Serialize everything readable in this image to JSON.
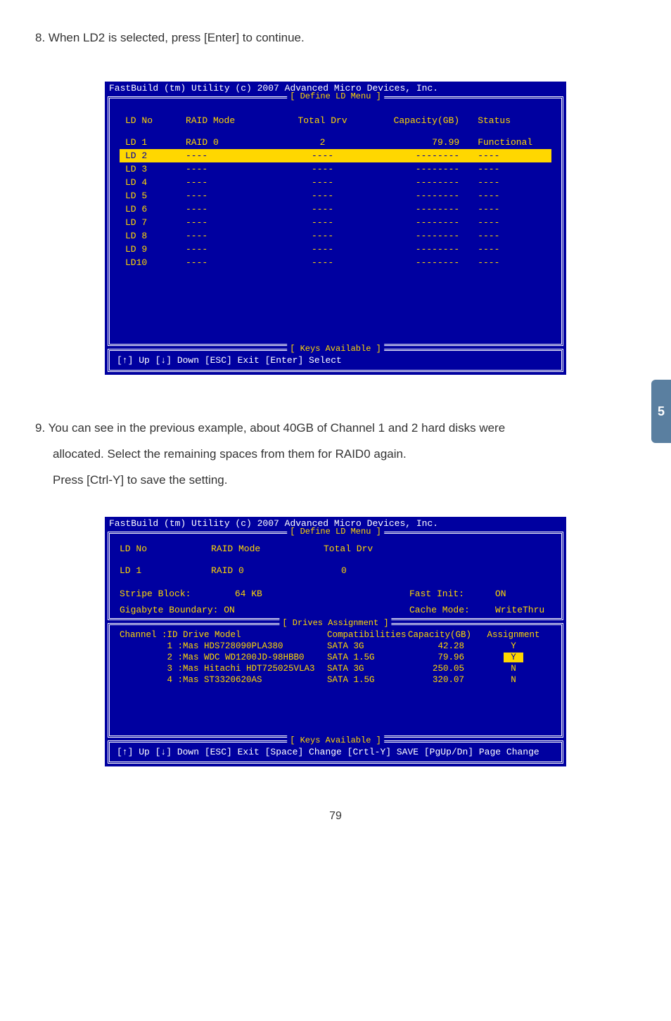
{
  "step8": "8. When LD2 is selected, press [Enter] to continue.",
  "step9_line1": "9. You can see in the previous example, about 40GB of Channel 1 and 2 hard disks were",
  "step9_line2": "allocated. Select the remaining spaces from them for RAID0 again.",
  "step9_line3": "Press [Ctrl-Y] to save the setting.",
  "bios_title": "FastBuild (tm) Utility (c) 2007 Advanced Micro Devices, Inc.",
  "frame1_title": "[ Define LD Menu ]",
  "keys_title": "[ Keys Available ]",
  "drives_title": "[ Drives Assignment ]",
  "screen1": {
    "headers": {
      "ldno": "LD No",
      "raid": "RAID Mode",
      "total": "Total Drv",
      "cap": "Capacity(GB)",
      "status": "Status"
    },
    "rows": [
      {
        "ldno": "LD  1",
        "raid": "RAID 0",
        "total": "2",
        "cap": "79.99",
        "status": "Functional",
        "selected": false
      },
      {
        "ldno": "LD  2",
        "raid": "----",
        "total": "----",
        "cap": "--------",
        "status": "----",
        "selected": true
      },
      {
        "ldno": "LD  3",
        "raid": "----",
        "total": "----",
        "cap": "--------",
        "status": "----",
        "selected": false
      },
      {
        "ldno": "LD  4",
        "raid": "----",
        "total": "----",
        "cap": "--------",
        "status": "----",
        "selected": false
      },
      {
        "ldno": "LD  5",
        "raid": "----",
        "total": "----",
        "cap": "--------",
        "status": "----",
        "selected": false
      },
      {
        "ldno": "LD  6",
        "raid": "----",
        "total": "----",
        "cap": "--------",
        "status": "----",
        "selected": false
      },
      {
        "ldno": "LD  7",
        "raid": "----",
        "total": "----",
        "cap": "--------",
        "status": "----",
        "selected": false
      },
      {
        "ldno": "LD  8",
        "raid": "----",
        "total": "----",
        "cap": "--------",
        "status": "----",
        "selected": false
      },
      {
        "ldno": "LD  9",
        "raid": "----",
        "total": "----",
        "cap": "--------",
        "status": "----",
        "selected": false
      },
      {
        "ldno": "LD10",
        "raid": "----",
        "total": "----",
        "cap": "--------",
        "status": "----",
        "selected": false
      }
    ],
    "keys": "[↑] Up    [↓] Down    [ESC] Exit    [Enter] Select"
  },
  "screen2": {
    "ldno_label": "LD No",
    "raid_label": "RAID Mode",
    "total_label": "Total Drv",
    "ld_val": "LD  1",
    "raid_val": "RAID 0",
    "total_val": "0",
    "stripe_label": "Stripe Block:",
    "stripe_val": "64  KB",
    "giga_label": "Gigabyte Boundary:",
    "giga_val": "ON",
    "fast_label": "Fast Init:",
    "fast_val": "ON",
    "cache_label": "Cache Mode:",
    "cache_val": "WriteThru",
    "dheaders": {
      "channel": "Channel :ID  Drive Model",
      "compat": "Compatibilities",
      "cap": "Capacity(GB)",
      "assign": "Assignment"
    },
    "drows": [
      {
        "ch": "         1 :Mas HDS728090PLA380",
        "compat": "SATA 3G",
        "cap": "42.28",
        "assign": "Y",
        "boxed": false
      },
      {
        "ch": "         2 :Mas WDC WD1200JD-98HBB0",
        "compat": "SATA 1.5G",
        "cap": "79.96",
        "assign": "Y",
        "boxed": true
      },
      {
        "ch": "         3 :Mas Hitachi HDT725025VLA3",
        "compat": "SATA 3G",
        "cap": "250.05",
        "assign": "N",
        "boxed": false
      },
      {
        "ch": "         4 :Mas ST3320620AS",
        "compat": "SATA 1.5G",
        "cap": "320.07",
        "assign": "N",
        "boxed": false
      }
    ],
    "keys": "[↑] Up  [↓] Down  [ESC] Exit  [Space] Change  [Crtl-Y] SAVE   [PgUp/Dn] Page Change"
  },
  "side_tab": "5",
  "page_number": "79"
}
